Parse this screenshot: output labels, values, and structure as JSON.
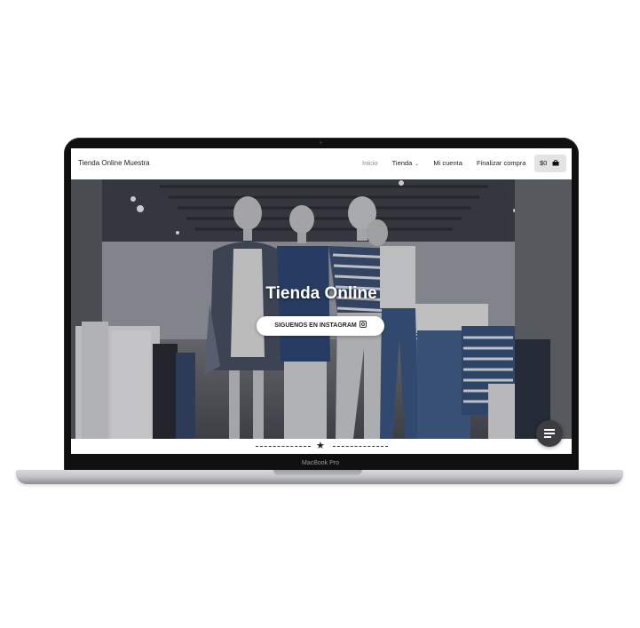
{
  "device": {
    "brand_label": "MacBook Pro"
  },
  "header": {
    "site_title": "Tienda Online Muestra",
    "nav": {
      "home": "Inicio",
      "shop": "Tienda",
      "account": "Mi cuenta",
      "checkout": "Finalizar compra"
    },
    "cart": {
      "amount": "$0",
      "icon": "shopping-bag-icon"
    }
  },
  "hero": {
    "title": "Tienda Online",
    "button_label": "SIGUENOS EN INSTAGRAM",
    "button_icon": "instagram-icon"
  },
  "divider": {
    "icon": "star-icon"
  },
  "menu_button": {
    "icon": "menu-icon"
  },
  "colors": {
    "cart_bg": "#e3e3e3",
    "fab_bg": "#3d3d3f",
    "nav_active": "#8a8a8a",
    "laptop_frame": "#0f0f10"
  }
}
